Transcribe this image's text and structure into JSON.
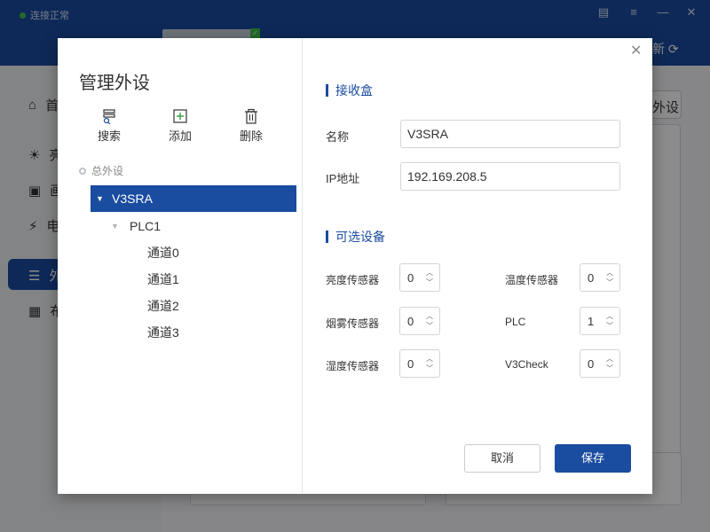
{
  "app": {
    "connection_status": "连接正常",
    "header_right_label": "新",
    "sidebar_items": [
      {
        "label": "首",
        "icon": "home-icon"
      },
      {
        "label": "亮",
        "icon": "sun-icon"
      },
      {
        "label": "画",
        "icon": "image-icon"
      },
      {
        "label": "电",
        "icon": "power-icon"
      },
      {
        "label": "外",
        "icon": "list-icon"
      },
      {
        "label": "布",
        "icon": "layout-icon"
      }
    ],
    "bg_button_label": "外设",
    "accent_color": "#1a4ca0",
    "status_color": "#3ec24b"
  },
  "dialog": {
    "title": "管理外设",
    "toolbar": {
      "search": "搜索",
      "add": "添加",
      "delete": "删除"
    },
    "tree": {
      "root": "总外设",
      "selected": "V3SRA",
      "child": "PLC1",
      "channels": [
        "通道0",
        "通道1",
        "通道2",
        "通道3"
      ]
    },
    "receiver": {
      "section_title": "接收盒",
      "name_label": "名称",
      "name_value": "V3SRA",
      "ip_label": "IP地址",
      "ip_value": "192.169.208.5"
    },
    "optional": {
      "section_title": "可选设备",
      "devices": [
        {
          "label": "亮度传感器",
          "value": "0"
        },
        {
          "label": "温度传感器",
          "value": "0"
        },
        {
          "label": "烟雾传感器",
          "value": "0"
        },
        {
          "label": "PLC",
          "value": "1"
        },
        {
          "label": "湿度传感器",
          "value": "0"
        },
        {
          "label": "V3Check",
          "value": "0"
        }
      ]
    },
    "buttons": {
      "cancel": "取消",
      "save": "保存"
    }
  }
}
